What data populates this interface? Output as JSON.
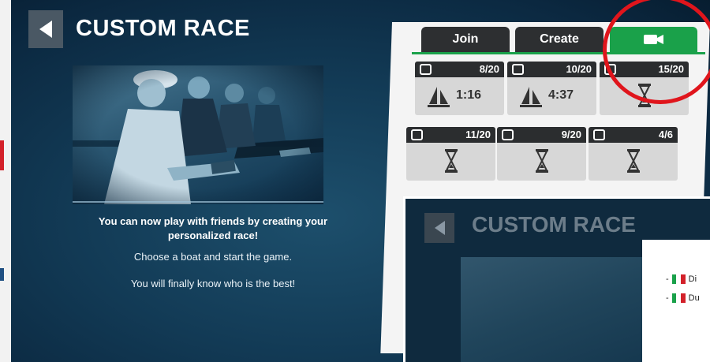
{
  "header": {
    "title": "CUSTOM RACE"
  },
  "description": {
    "line1": "You can now play with friends by creating your",
    "line2": "personalized race!",
    "line3": "Choose a boat and start the game.",
    "line4": "You will finally know who is the best!"
  },
  "tabs": [
    {
      "label": "Join"
    },
    {
      "label": "Create"
    },
    {
      "icon": "camera-icon"
    }
  ],
  "races": [
    {
      "count": "8/20",
      "time": "1:16",
      "icon": "sailboat-icon",
      "type": "sail"
    },
    {
      "count": "10/20",
      "time": "4:37",
      "icon": "sailboat-icon",
      "type": "sail"
    },
    {
      "count": "15/20",
      "time": "",
      "icon": "hourglass-icon",
      "type": "lock"
    },
    {
      "count": "11/20",
      "time": "",
      "icon": "hourglass-icon",
      "type": "lock"
    },
    {
      "count": "9/20",
      "time": "",
      "icon": "hourglass-icon",
      "type": "lock"
    },
    {
      "count": "4/6",
      "time": "",
      "icon": "hourglass-icon",
      "type": "lock"
    }
  ],
  "inset": {
    "title": "CUSTOM RACE",
    "rows": [
      {
        "prefix": "-",
        "text": "Di"
      },
      {
        "prefix": "-",
        "text": "Du"
      }
    ]
  },
  "colors": {
    "accent": "#1aa14a",
    "highlight": "#e0151c",
    "tab_dark": "#2d2f31"
  }
}
